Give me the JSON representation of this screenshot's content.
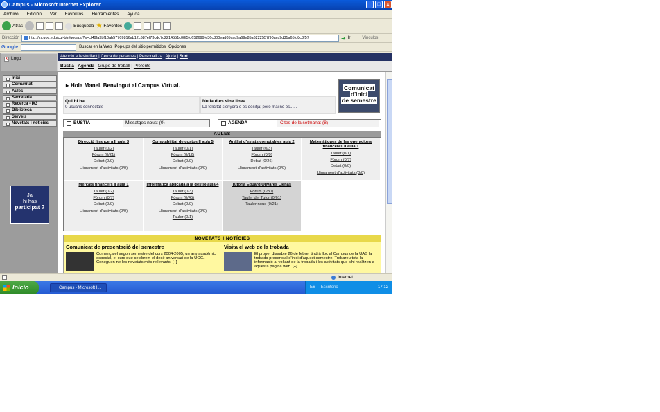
{
  "window": {
    "title": "Campus - Microsoft Internet Explorer",
    "min": "_",
    "max": "□",
    "close": "x"
  },
  "menu": [
    "Archivo",
    "Edición",
    "Ver",
    "Favoritos",
    "Herramientas",
    "Ayuda"
  ],
  "toolbar": {
    "back": "Atrás",
    "search": "Búsqueda",
    "favorites": "Favoritos"
  },
  "address": {
    "label": "Dirección",
    "url": "http://cv.uoc.edu/cgi-bin/uocapp?s=cf49fa9bf10ab57709816ab12c687ef73cdc7c2214551c08f5fd652699fe36c800ead05cac9a69e85a6222557f90acc9d31a65fd8c3f57",
    "go": "Ir",
    "links": "Vínculos"
  },
  "googlebar": {
    "logo": "Google",
    "search_web": "Buscar en la Web",
    "popups": "Pop-ups del sitio permitidos",
    "options": "Opciones"
  },
  "sidebar": {
    "logo": "Logo",
    "items": [
      "Inici",
      "Comunitat",
      "Aules",
      "Secretaria",
      "Recerca - I#3",
      "Biblioteca",
      "Serveis",
      "Novetats i notícies"
    ],
    "promo": {
      "line1": "Ja",
      "line2": "hi has",
      "line3": "participat ?"
    }
  },
  "topnav": {
    "items": [
      "Atenció a l'estudiant",
      "Cerca de persones",
      "Personalitza",
      "Ajuda",
      "Surt"
    ]
  },
  "subnav": {
    "items": [
      "Bústia",
      "Agenda",
      "Grups de treball",
      "Preferits"
    ]
  },
  "welcome": "Hola Manel. Benvingut al Campus Virtual.",
  "badge": {
    "line1": "Comunicat",
    "line2": "d'inici",
    "line3": "de semestre"
  },
  "who": {
    "title": "Qui hi ha",
    "value": "0 usuaris connectats"
  },
  "quote": {
    "title": "Nulla dies sine linea",
    "value": "La felicitat s'enyora o es desitja; però mai no es......"
  },
  "mailbox": {
    "label": "BÚSTIA",
    "value": "Missatges nous: (0)"
  },
  "agenda": {
    "label": "AGENDA",
    "value": "Cites de la setmana: (8)"
  },
  "classrooms": {
    "header": "AULES",
    "cells": [
      {
        "title": "Direcció financera II aula 3",
        "links": [
          "Tauler (0/2)",
          "Fòrum (0/21)",
          "Debat (0/0)",
          "Lliurament d'activitats (0/0)"
        ]
      },
      {
        "title": "Comptabilitat de costos II aula 5",
        "links": [
          "Tauler (0/1)",
          "Fòrum (0/12)",
          "Debat (0/0)",
          "Lliurament d'activitats (0/0)"
        ]
      },
      {
        "title": "Anàlisi d'estats comptables aula 2",
        "links": [
          "Tauler (0/3)",
          "Fòrum (0/0)",
          "Debat (0/26)",
          "Lliurament d'activitats (0/0)"
        ]
      },
      {
        "title": "Matemàtiques de les operacions financeres II aula 1",
        "links": [
          "Tauler (0/1)",
          "Fòrum (0/7)",
          "Debat (0/0)",
          "Lliurament d'activitats (0/0)"
        ]
      },
      {
        "title": "Mercats financers II aula 1",
        "links": [
          "Tauler (0/2)",
          "Fòrum (0/7)",
          "Debat (0/0)",
          "Lliurament d'activitats (0/0)"
        ]
      },
      {
        "title": "Informàtica aplicada a la gestió aula 4",
        "links": [
          "Tauler (0/3)",
          "Fòrum (0/45)",
          "Debat (0/0)",
          "Lliurament d'activitats (0/0)",
          "Tauler (0/1)"
        ]
      },
      {
        "title": "Tutoria Eduard Olivares Llenas",
        "links": [
          "Fòrum (0/30)",
          "Tauler del Tutor (0/61)",
          "Tauler nous (0/21)"
        ]
      }
    ]
  },
  "news": {
    "header": "NOVETATS I NOTÍCIES",
    "items": [
      {
        "title": "Comunicat de presentació del semestre",
        "text": "Comença el segon semestre del curs 2004-2005, un any acadèmic especial, el curs que celebrem el desè aniversari de la UOC. Coneguen-ne les novetats més rellevants. [+]"
      },
      {
        "title": "Visita el web de la trobada",
        "text": "El proper dissabte 26 de febrer tindrà lloc al Campus de la UAB la trobada presencial d'inici d'aquest semestre. Trobareu tota la informació al voltant de la trobada i les activitats que s'hi realitzen a aquesta pàgina web. [+]"
      }
    ]
  },
  "status": {
    "zone": "Internet"
  },
  "taskbar": {
    "start": "Inicio",
    "task": "Campus - Microsoft I...",
    "lang": "ES",
    "desk": "Escritorio",
    "clock": "17:12"
  }
}
